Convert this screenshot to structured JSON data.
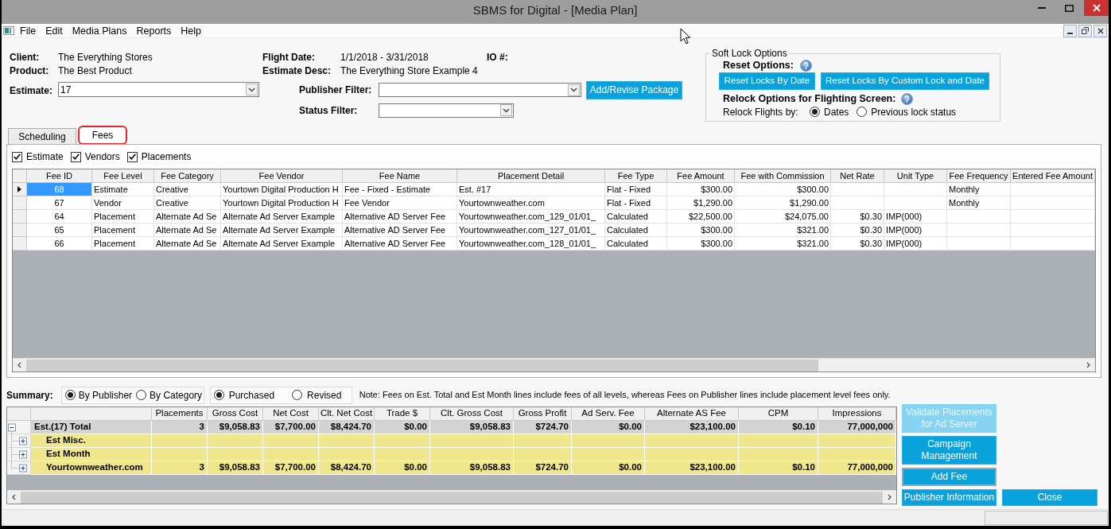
{
  "window": {
    "title": "SBMS for Digital - [Media Plan]"
  },
  "menu": [
    "File",
    "Edit",
    "Media Plans",
    "Reports",
    "Help"
  ],
  "header": {
    "client_label": "Client:",
    "client": "The Everything Stores",
    "product_label": "Product:",
    "product": "The Best Product",
    "estimate_label": "Estimate:",
    "estimate": "17",
    "flight_date_label": "Flight Date:",
    "flight_date": "1/1/2018 - 3/31/2018",
    "estimate_desc_label": "Estimate Desc:",
    "estimate_desc": "The Everything Store Example 4",
    "io_label": "IO #:",
    "publisher_filter_label": "Publisher Filter:",
    "status_filter_label": "Status Filter:",
    "add_revise_button": "Add/Revise Package"
  },
  "soft_lock": {
    "title": "Soft Lock Options",
    "reset_label": "Reset Options:",
    "reset_buttons": [
      "Reset Locks By Date",
      "Reset Locks By Custom Lock and Date"
    ],
    "relock_label": "Relock Options for Flighting Screen:",
    "relock_by_label": "Relock Flights by:",
    "relock_by": [
      {
        "label": "Dates",
        "selected": true
      },
      {
        "label": "Previous lock status",
        "selected": false
      }
    ]
  },
  "tabs": [
    {
      "label": "Scheduling",
      "selected": false
    },
    {
      "label": "Fees",
      "selected": true
    }
  ],
  "fee_filters": [
    {
      "label": "Estimate",
      "checked": true
    },
    {
      "label": "Vendors",
      "checked": true
    },
    {
      "label": "Placements",
      "checked": true
    }
  ],
  "fees_table": {
    "columns": [
      "Fee ID",
      "Fee Level",
      "Fee Category",
      "Fee Vendor",
      "Fee Name",
      "Placement Detail",
      "Fee Type",
      "Fee Amount",
      "Fee with Commission",
      "Net Rate",
      "Unit Type",
      "Fee Frequency",
      "Entered Fee Amount"
    ],
    "rows": [
      {
        "selected": true,
        "cells": [
          "68",
          "Estimate",
          "Creative",
          "Yourtown Digital Production H",
          "Fee - Fixed - Estimate",
          "Est. #17",
          "Flat - Fixed",
          "$300.00",
          "$300.00",
          null,
          null,
          "Monthly",
          null
        ]
      },
      {
        "selected": false,
        "cells": [
          "67",
          "Vendor",
          "Creative",
          "Yourtown Digital Production H",
          "Fee Vendor",
          "Yourtownweather.com",
          "Flat - Fixed",
          "$1,290.00",
          "$1,290.00",
          null,
          null,
          "Monthly",
          null
        ]
      },
      {
        "selected": false,
        "cells": [
          "64",
          "Placement",
          "Alternate Ad Se",
          "Alternate Ad Server Example",
          "Alternative AD Server Fee",
          "Yourtownweather.com_129_01/01_",
          "Calculated",
          "$22,500.00",
          "$24,075.00",
          "$0.30",
          "IMP(000)",
          null,
          null
        ]
      },
      {
        "selected": false,
        "cells": [
          "65",
          "Placement",
          "Alternate Ad Se",
          "Alternate Ad Server Example",
          "Alternative AD Server Fee",
          "Yourtownweather.com_127_01/01_",
          "Calculated",
          "$300.00",
          "$321.00",
          "$0.30",
          "IMP(000)",
          null,
          null
        ]
      },
      {
        "selected": false,
        "cells": [
          "66",
          "Placement",
          "Alternate Ad Se",
          "Alternate Ad Server Example",
          "Alternative AD Server Fee",
          "Yourtownweather.com_128_01/01_",
          "Calculated",
          "$300.00",
          "$321.00",
          "$0.30",
          "IMP(000)",
          null,
          null
        ]
      }
    ]
  },
  "summary": {
    "label": "Summary:",
    "view_by": [
      {
        "label": "By Publisher",
        "selected": true
      },
      {
        "label": "By Category",
        "selected": false
      }
    ],
    "cost_basis": [
      {
        "label": "Purchased",
        "selected": true
      },
      {
        "label": "Revised",
        "selected": false
      }
    ],
    "note": "Note: Fees on Est. Total and Est Month lines include fees of all levels, whereas Fees on Publisher lines include placement level fees only."
  },
  "summary_table": {
    "columns": [
      "Placements",
      "Gross Cost",
      "Net Cost",
      "Clt. Net Cost",
      "Trade $",
      "Clt. Gross Cost",
      "Gross Profit",
      "Ad Serv. Fee",
      "Alternate AS Fee",
      "CPM",
      "Impressions"
    ],
    "rows": [
      {
        "name": "Est.(17) Total",
        "expanded": true,
        "cells": [
          "3",
          "$9,058.83",
          "$7,700.00",
          "$8,424.70",
          "$0.00",
          "$9,058.83",
          "$724.70",
          "$0.00",
          "$23,100.00",
          "$0.10",
          "77,000,000"
        ],
        "children": [
          {
            "name": "Est Misc.",
            "expanded": false
          },
          {
            "name": "Est Month",
            "expanded": false
          },
          {
            "name": "Yourtownweather.com",
            "expanded": false,
            "cells": [
              "3",
              "$9,058.83",
              "$7,700.00",
              "$8,424.70",
              "$0.00",
              "$9,058.83",
              "$724.70",
              "$0.00",
              "$23,100.00",
              "$0.10",
              "77,000,000"
            ]
          }
        ]
      }
    ]
  },
  "actions": [
    {
      "label": "Validate Placements for Ad Server",
      "disabled": true,
      "focused": false
    },
    {
      "label": "Campaign Management",
      "disabled": false,
      "focused": false
    },
    {
      "label": "Add Fee",
      "disabled": false,
      "focused": true
    },
    {
      "label": "Publisher Information",
      "disabled": false,
      "focused": false
    },
    {
      "label": "Close",
      "disabled": false,
      "focused": false
    }
  ]
}
